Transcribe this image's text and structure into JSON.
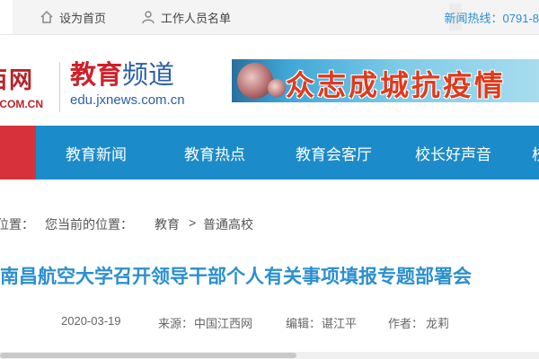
{
  "topbar": {
    "set_home_label": "设为首页",
    "staff_list_label": "工作人员名单",
    "hotline_label": "新闻热线：0791-8"
  },
  "header": {
    "site_logo_text": "西网",
    "site_logo_domain": "S.COM.CN",
    "edu_logo_red": "教育",
    "edu_logo_blue": "频道",
    "edu_logo_url": "edu.jxnews.com.cn",
    "banner_slogan": "众志成城抗疫情"
  },
  "nav": {
    "items": [
      {
        "label": "教育新闻"
      },
      {
        "label": "教育热点"
      },
      {
        "label": "教育会客厅"
      },
      {
        "label": "校长好声音"
      },
      {
        "label": "校"
      }
    ]
  },
  "breadcrumb": {
    "prefix": "位置：",
    "current_label": "您当前的位置：",
    "level1": "教育",
    "separator": ">",
    "level2": "普通高校"
  },
  "article": {
    "title": "南昌航空大学召开领导干部个人有关事项填报专题部署会",
    "date": "2020-03-19",
    "source_label": "来源：",
    "source": "中国江西网",
    "editor_label": "编辑：",
    "editor": "谌江平",
    "author_label": "作者：",
    "author": "龙莉"
  },
  "colors": {
    "nav_blue": "#1c8bc9",
    "accent_red": "#d7323b",
    "title_blue": "#2b8fd0"
  }
}
